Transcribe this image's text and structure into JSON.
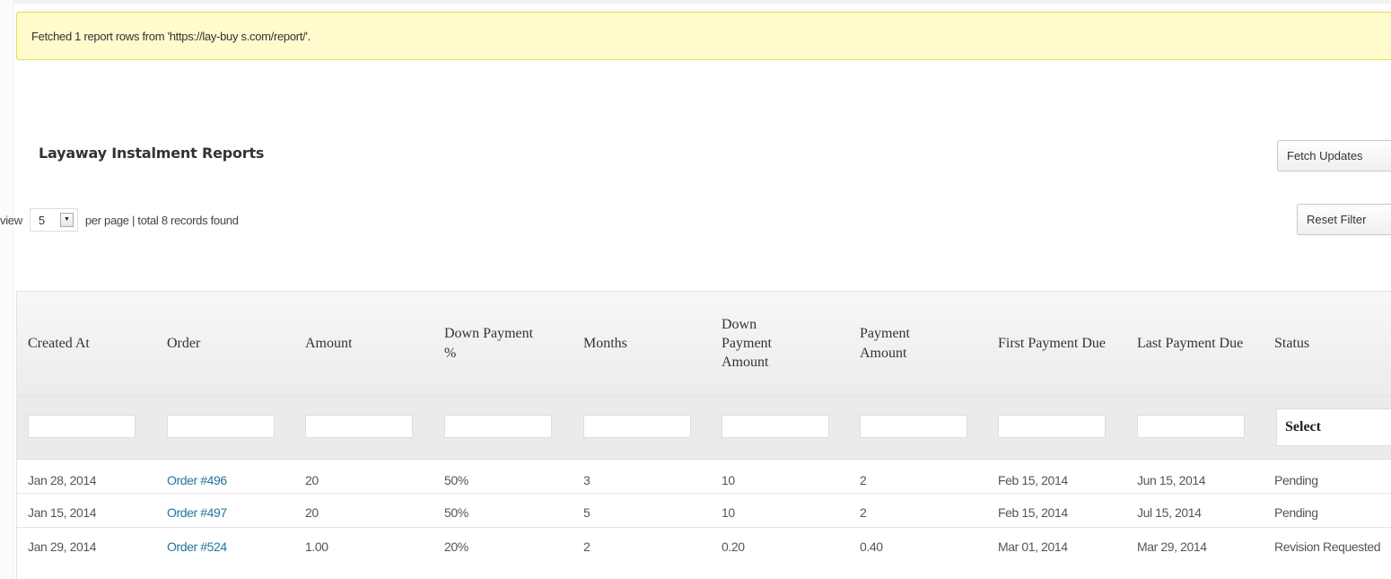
{
  "notice": {
    "text": "Fetched 1 report rows from 'https://lay-buy s.com/report/'."
  },
  "report": {
    "title": "Layaway Instalment Reports",
    "fetch_button": "Fetch Updates",
    "reset_button": "Reset Filter"
  },
  "pager": {
    "view_label": "view",
    "per_page_value": "5",
    "summary": "per page | total 8 records found"
  },
  "table": {
    "columns": [
      "Created At",
      "Order",
      "Amount",
      "Down Payment %",
      "Months",
      "Down Payment Amount",
      "Payment Amount",
      "First Payment Due",
      "Last Payment Due",
      "Status"
    ],
    "status_filter_value": "Select",
    "rows": [
      {
        "created_at": "Jan 28, 2014",
        "order": "Order #496",
        "amount": "20",
        "down_payment_pct": "50%",
        "months": "3",
        "down_payment_amount": "10",
        "payment_amount": "2",
        "first_payment_due": "Feb 15, 2014",
        "last_payment_due": "Jun 15, 2014",
        "status": "Pending"
      },
      {
        "created_at": "Jan 15, 2014",
        "order": "Order #497",
        "amount": "20",
        "down_payment_pct": "50%",
        "months": "5",
        "down_payment_amount": "10",
        "payment_amount": "2",
        "first_payment_due": "Feb 15, 2014",
        "last_payment_due": "Jul 15, 2014",
        "status": "Pending"
      },
      {
        "created_at": "Jan 29, 2014",
        "order": "Order #524",
        "amount": "1.00",
        "down_payment_pct": "20%",
        "months": "2",
        "down_payment_amount": "0.20",
        "payment_amount": "0.40",
        "first_payment_due": "Mar 01, 2014",
        "last_payment_due": "Mar 29, 2014",
        "status": "Revision Requested"
      }
    ]
  }
}
